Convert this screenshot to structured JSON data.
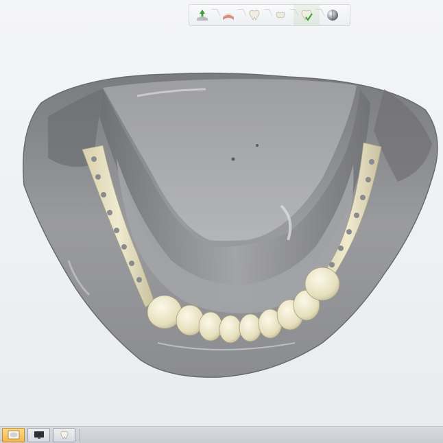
{
  "toolbar": {
    "steps": [
      {
        "icon": "download-scan-icon",
        "state": "done"
      },
      {
        "icon": "gum-arch-icon",
        "state": "done"
      },
      {
        "icon": "tooth-icon",
        "state": "done"
      },
      {
        "icon": "tooth-small-icon",
        "state": "done"
      },
      {
        "icon": "tooth-check-icon",
        "state": "active"
      },
      {
        "icon": "export-sphere-icon",
        "state": "pending"
      }
    ]
  },
  "viewport": {
    "model": "denture-base-with-teeth",
    "colors": {
      "gingiva": "#8e8f92",
      "teeth": "#ece6c6",
      "flange_bar": "#e9e3c2",
      "background_top": "#f4f5f7"
    }
  },
  "taskbar": {
    "buttons": [
      {
        "icon": "model-window-icon",
        "active": true
      },
      {
        "icon": "monitor-icon",
        "active": false
      },
      {
        "icon": "tooth-window-icon",
        "active": false
      }
    ]
  }
}
